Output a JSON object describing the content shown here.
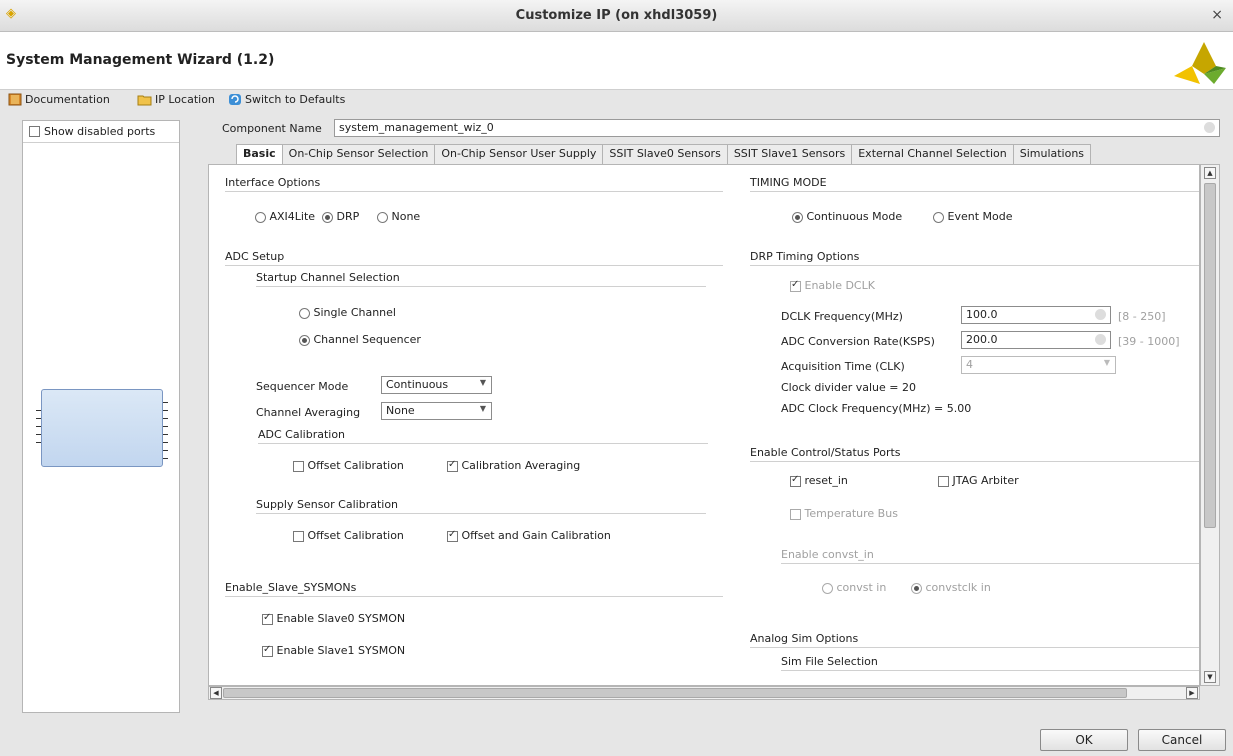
{
  "window": {
    "title": "Customize IP (on xhdl3059)",
    "close_glyph": "×"
  },
  "header": {
    "wizard_title": "System Management Wizard (1.2)"
  },
  "toolbar": {
    "documentation": "Documentation",
    "ip_location": "IP Location",
    "switch_defaults": "Switch to Defaults"
  },
  "left_panel": {
    "show_disabled_ports": "Show disabled ports"
  },
  "component": {
    "label": "Component Name",
    "value": "system_management_wiz_0"
  },
  "tabs": [
    "Basic",
    "On-Chip Sensor Selection",
    "On-Chip Sensor User Supply",
    "SSIT Slave0 Sensors",
    "SSIT Slave1 Sensors",
    "External Channel Selection",
    "Simulations"
  ],
  "basic": {
    "interface_options": {
      "title": "Interface Options",
      "axi4lite": "AXI4Lite",
      "drp": "DRP",
      "none": "None"
    },
    "adc_setup": {
      "title": "ADC Setup",
      "startup_channel_selection": "Startup Channel Selection",
      "single_channel": "Single Channel",
      "channel_sequencer": "Channel Sequencer",
      "sequencer_mode_label": "Sequencer Mode",
      "sequencer_mode_value": "Continuous",
      "channel_averaging_label": "Channel Averaging",
      "channel_averaging_value": "None",
      "adc_calibration": "ADC Calibration",
      "offset_calibration": "Offset Calibration",
      "calibration_averaging": "Calibration  Averaging",
      "supply_sensor_calibration": "Supply Sensor Calibration",
      "supply_offset_calibration": "Offset Calibration",
      "offset_gain_calibration": "Offset and Gain Calibration"
    },
    "enable_slave": {
      "title": "Enable_Slave_SYSMONs",
      "slave0": "Enable Slave0 SYSMON",
      "slave1": "Enable Slave1 SYSMON"
    },
    "timing_mode": {
      "title": "TIMING MODE",
      "continuous": "Continuous Mode",
      "event": "Event Mode"
    },
    "drp_timing": {
      "title": "DRP Timing Options",
      "enable_dclk": "Enable DCLK",
      "dclk_label": "DCLK Frequency(MHz)",
      "dclk_value": "100.0",
      "dclk_range": "[8 - 250]",
      "adc_rate_label": "ADC Conversion Rate(KSPS)",
      "adc_rate_value": "200.0",
      "adc_rate_range": "[39 - 1000]",
      "acq_time_label": "Acquisition Time (CLK)",
      "acq_time_value": "4",
      "clock_divider": "Clock divider value = 20",
      "adc_clock_freq": "ADC Clock Frequency(MHz) = 5.00"
    },
    "control_ports": {
      "title": "Enable Control/Status Ports",
      "reset_in": "reset_in",
      "jtag_arbiter": "JTAG Arbiter",
      "temperature_bus": "Temperature Bus",
      "enable_convst_in": "Enable convst_in",
      "convst_in": "convst in",
      "convstclk_in": "convstclk in"
    },
    "analog_sim": {
      "title": "Analog Sim Options",
      "sim_file_selection": "Sim File Selection"
    }
  },
  "buttons": {
    "ok": "OK",
    "cancel": "Cancel"
  },
  "colors": {
    "logo_yellow": "#f2c200",
    "logo_green": "#6cab2e",
    "symbol_fill": "#c2d6ef"
  }
}
